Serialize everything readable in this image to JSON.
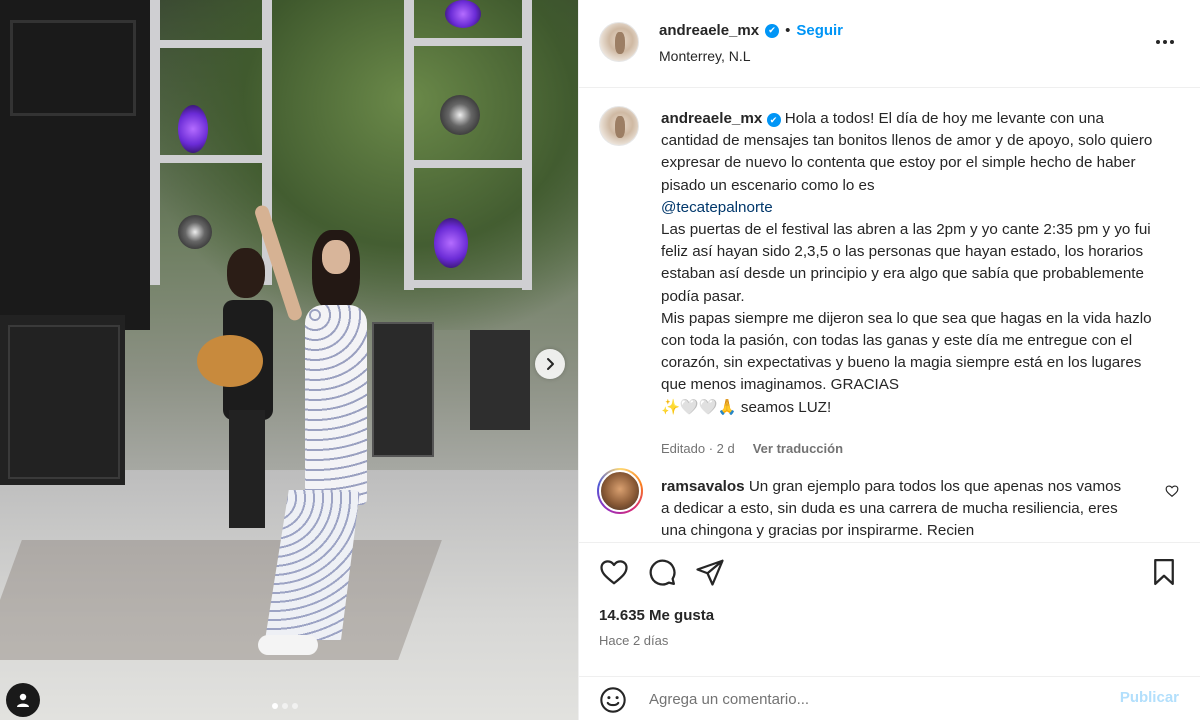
{
  "post": {
    "username": "andreaele_mx",
    "verified_glyph": "✔",
    "separator": "•",
    "follow_label": "Seguir",
    "location": "Monterrey, N.L"
  },
  "caption": {
    "username": "andreaele_mx",
    "text_1": "Hola a todos! El día de hoy me levante con una cantidad de mensajes tan bonitos llenos de amor y de apoyo, solo quiero expresar de nuevo lo contenta que estoy por el simple hecho de haber pisado un escenario como lo es",
    "mention": "@tecatepalnorte",
    "text_2": "Las puertas de el festival las abren a las 2pm y yo cante 2:35 pm y yo fui feliz así hayan sido 2,3,5 o las personas que hayan estado, los horarios estaban así desde un principio y era algo que sabía que probablemente podía pasar.",
    "text_3": "Mis papas siempre me dijeron sea lo que sea que hagas en la vida hazlo con toda la pasión, con todas las ganas y este día me entregue con el corazón, sin expectativas y bueno la magia siempre está en los lugares que menos imaginamos. GRACIAS",
    "text_4": "✨🤍🤍🙏 seamos LUZ!",
    "edited": "Editado · 2 d",
    "translate_label": "Ver traducción"
  },
  "comment": {
    "username": "ramsavalos",
    "text": "Un gran ejemplo para todos los que apenas nos vamos a dedicar a esto, sin duda es una carrera de mucha resiliencia, eres una chingona y gracias por inspirarme. Recien"
  },
  "stats": {
    "likes": "14.635 Me gusta",
    "time_ago": "Hace 2 días"
  },
  "add_comment": {
    "placeholder": "Agrega un comentario...",
    "post_label": "Publicar"
  },
  "media": {
    "carousel_current": 1,
    "carousel_total": 3
  },
  "icons": {
    "like": "heart-icon",
    "comment": "comment-icon",
    "share": "share-icon",
    "save": "bookmark-icon",
    "more": "more-icon",
    "emoji": "emoji-icon",
    "next": "chevron-right-icon",
    "tagged": "user-tag-icon"
  },
  "colors": {
    "link_blue": "#0095f6",
    "mention_blue": "#00376b",
    "muted": "#737373",
    "post_disabled": "#b2dffc"
  }
}
